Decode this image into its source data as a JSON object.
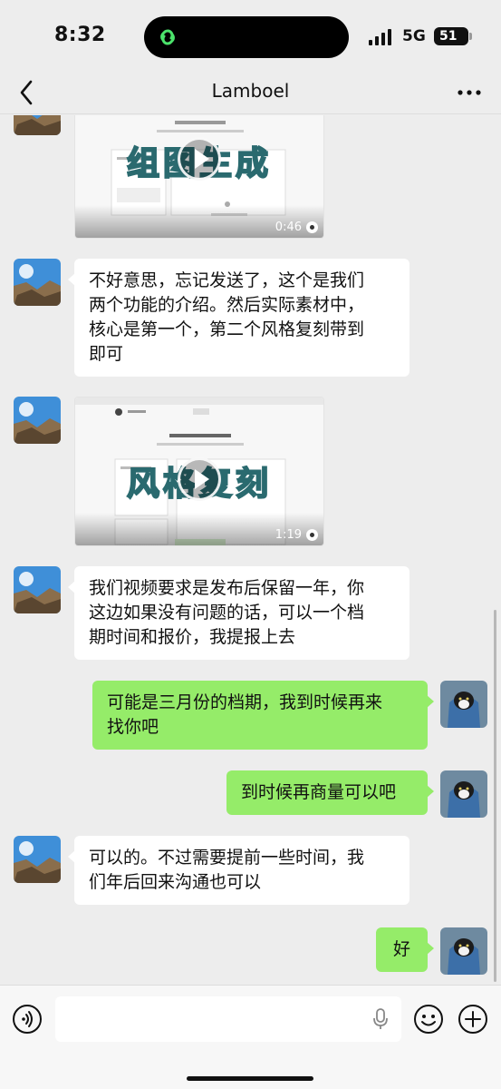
{
  "status_bar": {
    "time": "8:32",
    "network": "5G",
    "battery": "51"
  },
  "nav": {
    "title": "Lamboel"
  },
  "messages": [
    {
      "type": "video",
      "from": "contact",
      "overlay": "组图生成",
      "duration": "0:46"
    },
    {
      "type": "text",
      "from": "contact",
      "lines": [
        "不好意思，忘记发送了，这个是我们",
        "两个功能的介绍。然后实际素材中，",
        "核心是第一个，第二个风格复刻带到",
        "即可"
      ]
    },
    {
      "type": "video",
      "from": "contact",
      "overlay": "风格复刻",
      "duration": "1:19"
    },
    {
      "type": "text",
      "from": "contact",
      "lines": [
        "我们视频要求是发布后保留一年，你",
        "这边如果没有问题的话，可以一个档",
        "期时间和报价，我提报上去"
      ]
    },
    {
      "type": "text",
      "from": "me",
      "lines": [
        "可能是三月份的档期，我到时候再来",
        "找你吧"
      ]
    },
    {
      "type": "text",
      "from": "me",
      "lines": [
        "到时候再商量可以吧"
      ]
    },
    {
      "type": "text",
      "from": "contact",
      "lines": [
        "可以的。不过需要提前一些时间，我",
        "们年后回来沟通也可以"
      ]
    },
    {
      "type": "text",
      "from": "me",
      "lines": [
        "好"
      ]
    }
  ],
  "colors": {
    "outgoing_bubble": "#95ec69",
    "incoming_bubble": "#ffffff",
    "background": "#ededed"
  },
  "input_bar": {
    "icons": [
      "voice-icon",
      "mic-icon",
      "emoji-icon",
      "add-icon"
    ]
  }
}
